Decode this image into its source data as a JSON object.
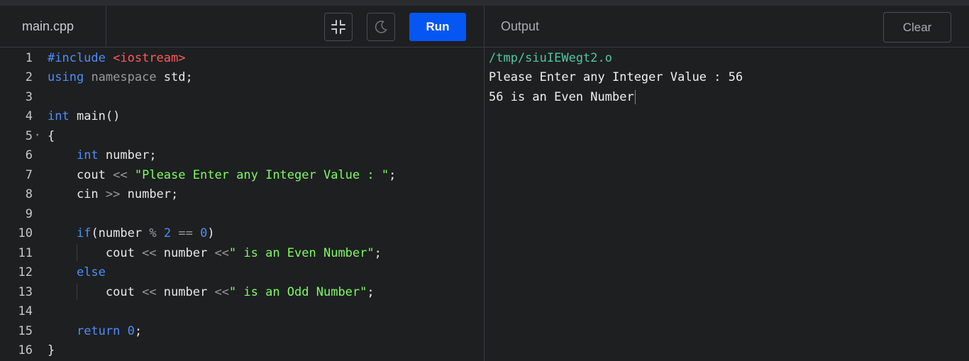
{
  "editor": {
    "file_name": "main.cpp",
    "run_label": "Run",
    "buttons": {
      "compress_icon": "compress-icon",
      "theme_icon": "moon-icon"
    },
    "lines": [
      {
        "n": "1",
        "tokens": [
          [
            "kw",
            "#include "
          ],
          [
            "inc",
            "<iostream>"
          ]
        ]
      },
      {
        "n": "2",
        "tokens": [
          [
            "kw",
            "using"
          ],
          [
            "plain",
            " "
          ],
          [
            "kw2",
            "namespace"
          ],
          [
            "plain",
            " std;"
          ]
        ]
      },
      {
        "n": "3",
        "tokens": []
      },
      {
        "n": "4",
        "tokens": [
          [
            "kw",
            "int"
          ],
          [
            "plain",
            " main()"
          ]
        ]
      },
      {
        "n": "5",
        "fold": true,
        "tokens": [
          [
            "plain",
            "{"
          ]
        ]
      },
      {
        "n": "6",
        "tokens": [
          [
            "plain",
            "    "
          ],
          [
            "kw",
            "int"
          ],
          [
            "plain",
            " number;"
          ]
        ]
      },
      {
        "n": "7",
        "tokens": [
          [
            "plain",
            "    cout "
          ],
          [
            "op",
            "<<"
          ],
          [
            "plain",
            " "
          ],
          [
            "str",
            "\"Please Enter any Integer Value : \""
          ],
          [
            "plain",
            ";"
          ]
        ]
      },
      {
        "n": "8",
        "tokens": [
          [
            "plain",
            "    cin "
          ],
          [
            "op",
            ">>"
          ],
          [
            "plain",
            " number;"
          ]
        ]
      },
      {
        "n": "9",
        "tokens": []
      },
      {
        "n": "10",
        "tokens": [
          [
            "plain",
            "    "
          ],
          [
            "kw",
            "if"
          ],
          [
            "plain",
            "(number "
          ],
          [
            "op",
            "%"
          ],
          [
            "plain",
            " "
          ],
          [
            "num",
            "2"
          ],
          [
            "plain",
            " "
          ],
          [
            "op",
            "=="
          ],
          [
            "plain",
            " "
          ],
          [
            "num",
            "0"
          ],
          [
            "plain",
            ")"
          ]
        ]
      },
      {
        "n": "11",
        "guide": true,
        "tokens": [
          [
            "plain",
            "        cout "
          ],
          [
            "op",
            "<<"
          ],
          [
            "plain",
            " number "
          ],
          [
            "op",
            "<<"
          ],
          [
            "str",
            "\" is an Even Number\""
          ],
          [
            "plain",
            ";"
          ]
        ]
      },
      {
        "n": "12",
        "tokens": [
          [
            "plain",
            "    "
          ],
          [
            "kw",
            "else"
          ]
        ]
      },
      {
        "n": "13",
        "guide": true,
        "tokens": [
          [
            "plain",
            "        cout "
          ],
          [
            "op",
            "<<"
          ],
          [
            "plain",
            " number "
          ],
          [
            "op",
            "<<"
          ],
          [
            "str",
            "\" is an Odd Number\""
          ],
          [
            "plain",
            ";"
          ]
        ]
      },
      {
        "n": "14",
        "tokens": []
      },
      {
        "n": "15",
        "tokens": [
          [
            "plain",
            "    "
          ],
          [
            "kw",
            "return"
          ],
          [
            "plain",
            " "
          ],
          [
            "num",
            "0"
          ],
          [
            "plain",
            ";"
          ]
        ]
      },
      {
        "n": "16",
        "tokens": [
          [
            "plain",
            "}"
          ]
        ]
      }
    ]
  },
  "output": {
    "title": "Output",
    "clear_label": "Clear",
    "path": "/tmp/siuIEWegt2.o",
    "lines": [
      "Please Enter any Integer Value : 56",
      "56 is an Even Number"
    ]
  },
  "colors": {
    "run_button": "#0556f3",
    "background": "#1e1f21",
    "keyword": "#4d8ef7",
    "string": "#7cfc62",
    "include": "#ff5c5c",
    "output_path": "#4ec9a0"
  }
}
